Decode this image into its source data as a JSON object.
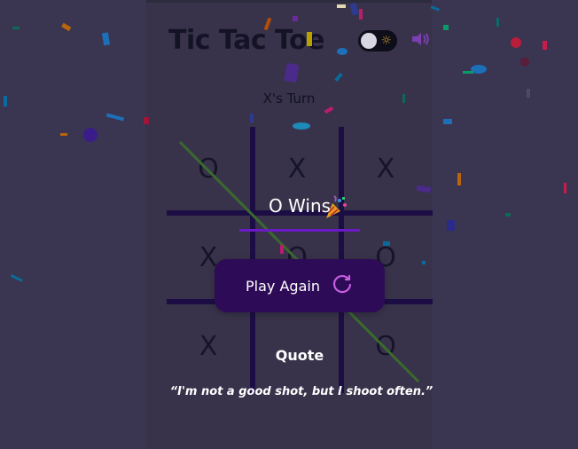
{
  "header": {
    "title": "Tic Tac Toe"
  },
  "status": {
    "turn": "X's Turn"
  },
  "board": {
    "cells": [
      "O",
      "X",
      "X",
      "X",
      "O",
      "O",
      "X",
      "",
      "O"
    ]
  },
  "result": {
    "message": "O Wins"
  },
  "actions": {
    "play_again": "Play Again"
  },
  "quote": {
    "title": "Quote",
    "text": "“I'm not a good shot, but I shoot often.”"
  },
  "colors": {
    "background": "#38334a",
    "grid": "#1c0e44",
    "button": "#2e0b57",
    "underline": "#6c19c8",
    "win_line": "#3a6a2e"
  },
  "icons": {
    "theme_toggle": "sun-toggle-icon",
    "sound": "speaker-icon",
    "celebration": "party-popper-icon",
    "replay": "refresh-icon"
  }
}
